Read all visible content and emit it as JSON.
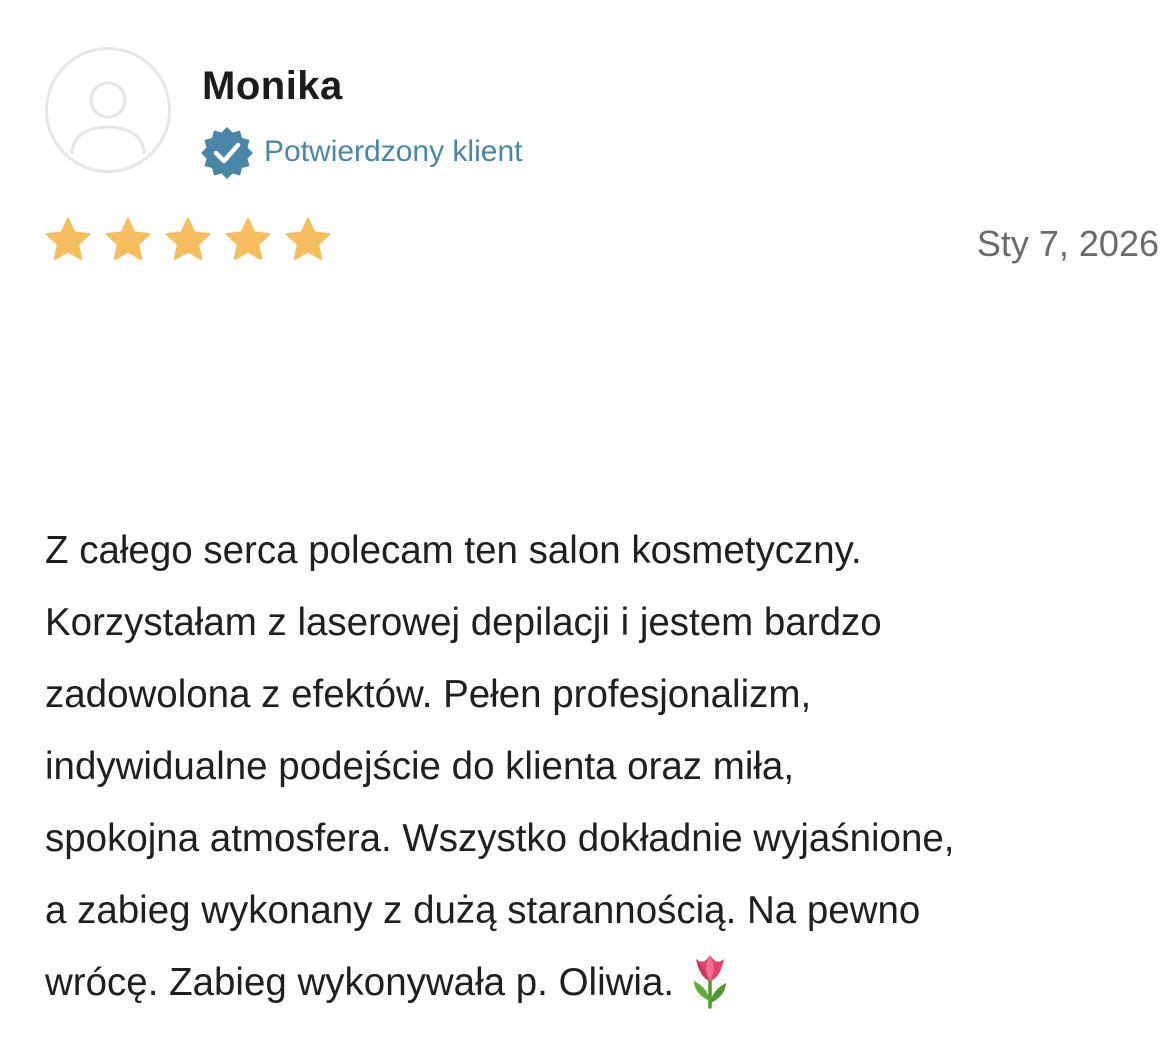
{
  "review": {
    "author": "Monika",
    "verified_label": "Potwierdzony klient",
    "rating": 5,
    "rating_max": 5,
    "date": "Sty 7, 2026",
    "text_lines": [
      "Z całego serca polecam ten salon kosmetyczny.",
      "Korzystałam z laserowej depilacji i jestem bardzo",
      "zadowolona z efektów. Pełen profesjonalizm,",
      "indywidualne podejście do klienta oraz miła,",
      "spokojna atmosfera. Wszystko dokładnie wyjaśnione,",
      "a zabieg wykonany z dużą starannością. Na pewno",
      "wrócę. Zabieg wykonywała p. Oliwia."
    ],
    "trailing_emoji_icon": "tulip-icon"
  },
  "colors": {
    "star": "#F7BE5F",
    "verified_badge": "#4A86A8",
    "verified_text": "#4A86A8",
    "date_text": "#6B6B6B",
    "avatar_outline": "#E6E6E6"
  },
  "icons": {
    "avatar": "user-placeholder-icon",
    "verified": "verified-badge-icon",
    "star": "star-icon"
  }
}
